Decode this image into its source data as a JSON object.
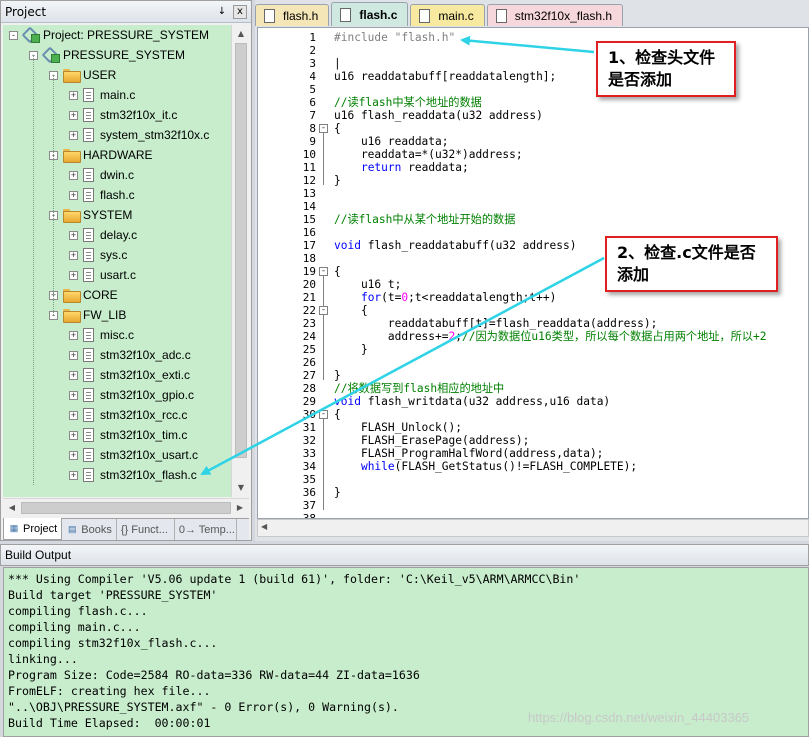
{
  "project_pane": {
    "title": "Project",
    "pin_icon": "pin-icon",
    "close_symbol": "x",
    "tree": {
      "root_label": "Project: PRESSURE_SYSTEM",
      "target_label": "PRESSURE_SYSTEM",
      "groups": [
        {
          "label": "USER",
          "expanded": true,
          "files": [
            "main.c",
            "stm32f10x_it.c",
            "system_stm32f10x.c"
          ]
        },
        {
          "label": "HARDWARE",
          "expanded": true,
          "files": [
            "dwin.c",
            "flash.c"
          ]
        },
        {
          "label": "SYSTEM",
          "expanded": true,
          "files": [
            "delay.c",
            "sys.c",
            "usart.c"
          ]
        },
        {
          "label": "CORE",
          "expanded": false,
          "files": []
        },
        {
          "label": "FW_LIB",
          "expanded": true,
          "files": [
            "misc.c",
            "stm32f10x_adc.c",
            "stm32f10x_exti.c",
            "stm32f10x_gpio.c",
            "stm32f10x_rcc.c",
            "stm32f10x_tim.c",
            "stm32f10x_usart.c",
            "stm32f10x_flash.c"
          ]
        }
      ]
    },
    "tabs": [
      {
        "label": "Project",
        "icon": "project-icon",
        "active": true
      },
      {
        "label": "Books",
        "icon": "books-icon",
        "active": false
      },
      {
        "label": "{} Funct...",
        "icon": "functions-icon",
        "active": false
      },
      {
        "label": "0→ Temp...",
        "icon": "templates-icon",
        "active": false
      }
    ]
  },
  "editor": {
    "tabs": [
      {
        "label": "flash.h",
        "color": "#f5e6b8",
        "active": false
      },
      {
        "label": "flash.c",
        "color": "#cfe8e0",
        "active": true
      },
      {
        "label": "main.c",
        "color": "#f7e9a0",
        "active": false
      },
      {
        "label": "stm32f10x_flash.h",
        "color": "#f6d8dc",
        "active": false
      }
    ],
    "line_numbers": [
      "1",
      "2",
      "3",
      "4",
      "5",
      "6",
      "7",
      "8",
      "9",
      "10",
      "11",
      "12",
      "13",
      "14",
      "15",
      "16",
      "17",
      "18",
      "19",
      "20",
      "21",
      "22",
      "23",
      "24",
      "25",
      "26",
      "27",
      "28",
      "29",
      "30",
      "31",
      "32",
      "33",
      "34",
      "35",
      "36",
      "37",
      "38"
    ],
    "code": [
      [
        {
          "t": "#include ",
          "c": "pp"
        },
        {
          "t": "\"flash.h\"",
          "c": "st"
        }
      ],
      [],
      [
        {
          "t": "|",
          "c": ""
        }
      ],
      [
        {
          "t": "u16 readdatabuff[readdatalength];",
          "c": ""
        }
      ],
      [],
      [
        {
          "t": "//读flash中某个地址的数据",
          "c": "cm"
        }
      ],
      [
        {
          "t": "u16 flash_readdata(u32 address)",
          "c": ""
        }
      ],
      [
        {
          "t": "{",
          "c": ""
        }
      ],
      [
        {
          "t": "    u16 readdata;",
          "c": ""
        }
      ],
      [
        {
          "t": "    readdata=*(u32*)address;",
          "c": ""
        }
      ],
      [
        {
          "t": "    ",
          "c": ""
        },
        {
          "t": "return",
          "c": "kw"
        },
        {
          "t": " readdata;",
          "c": ""
        }
      ],
      [
        {
          "t": "}",
          "c": ""
        }
      ],
      [],
      [],
      [
        {
          "t": "//读flash中从某个地址开始的数据",
          "c": "cm"
        }
      ],
      [],
      [
        {
          "t": "void",
          "c": "kw"
        },
        {
          "t": " flash_readdatabuff(u32 address)",
          "c": ""
        }
      ],
      [],
      [
        {
          "t": "{",
          "c": ""
        }
      ],
      [
        {
          "t": "    u16 t;",
          "c": ""
        }
      ],
      [
        {
          "t": "    ",
          "c": ""
        },
        {
          "t": "for",
          "c": "kw"
        },
        {
          "t": "(t=",
          "c": ""
        },
        {
          "t": "0",
          "c": "num"
        },
        {
          "t": ";t<readdatalength;t++)",
          "c": ""
        }
      ],
      [
        {
          "t": "    {",
          "c": ""
        }
      ],
      [
        {
          "t": "        readdatabuff[t]=flash_readdata(address);",
          "c": ""
        }
      ],
      [
        {
          "t": "        address+=",
          "c": ""
        },
        {
          "t": "2",
          "c": "num"
        },
        {
          "t": ";",
          "c": ""
        },
        {
          "t": "//因为数据位u16类型，所以每个数据占用两个地址，所以+2",
          "c": "cm"
        }
      ],
      [
        {
          "t": "    }",
          "c": ""
        }
      ],
      [],
      [
        {
          "t": "}",
          "c": ""
        }
      ],
      [
        {
          "t": "//将数据写到flash相应的地址中",
          "c": "cm"
        }
      ],
      [
        {
          "t": "void",
          "c": "kw"
        },
        {
          "t": " flash_writdata(u32 address,u16 data)",
          "c": ""
        }
      ],
      [
        {
          "t": "{",
          "c": ""
        }
      ],
      [
        {
          "t": "    FLASH_Unlock();",
          "c": ""
        }
      ],
      [
        {
          "t": "    FLASH_ErasePage(address);",
          "c": ""
        }
      ],
      [
        {
          "t": "    FLASH_ProgramHalfWord(address,data);",
          "c": ""
        }
      ],
      [
        {
          "t": "    ",
          "c": ""
        },
        {
          "t": "while",
          "c": "kw"
        },
        {
          "t": "(FLASH_GetStatus()!=FLASH_COMPLETE);",
          "c": ""
        }
      ],
      [],
      [
        {
          "t": "}",
          "c": ""
        }
      ],
      [],
      []
    ]
  },
  "callouts": [
    {
      "text": "1、检查头文件是否添加"
    },
    {
      "text": "2、检查.c文件是否添加"
    }
  ],
  "build_output": {
    "title": "Build Output",
    "lines": [
      "*** Using Compiler 'V5.06 update 1 (build 61)', folder: 'C:\\Keil_v5\\ARM\\ARMCC\\Bin'",
      "Build target 'PRESSURE_SYSTEM'",
      "compiling flash.c...",
      "compiling main.c...",
      "compiling stm32f10x_flash.c...",
      "linking...",
      "Program Size: Code=2584 RO-data=336 RW-data=44 ZI-data=1636",
      "FromELF: creating hex file...",
      "\"..\\OBJ\\PRESSURE_SYSTEM.axf\" - 0 Error(s), 0 Warning(s).",
      "Build Time Elapsed:  00:00:01"
    ],
    "watermark": "https://blog.csdn.net/weixin_44403365"
  }
}
